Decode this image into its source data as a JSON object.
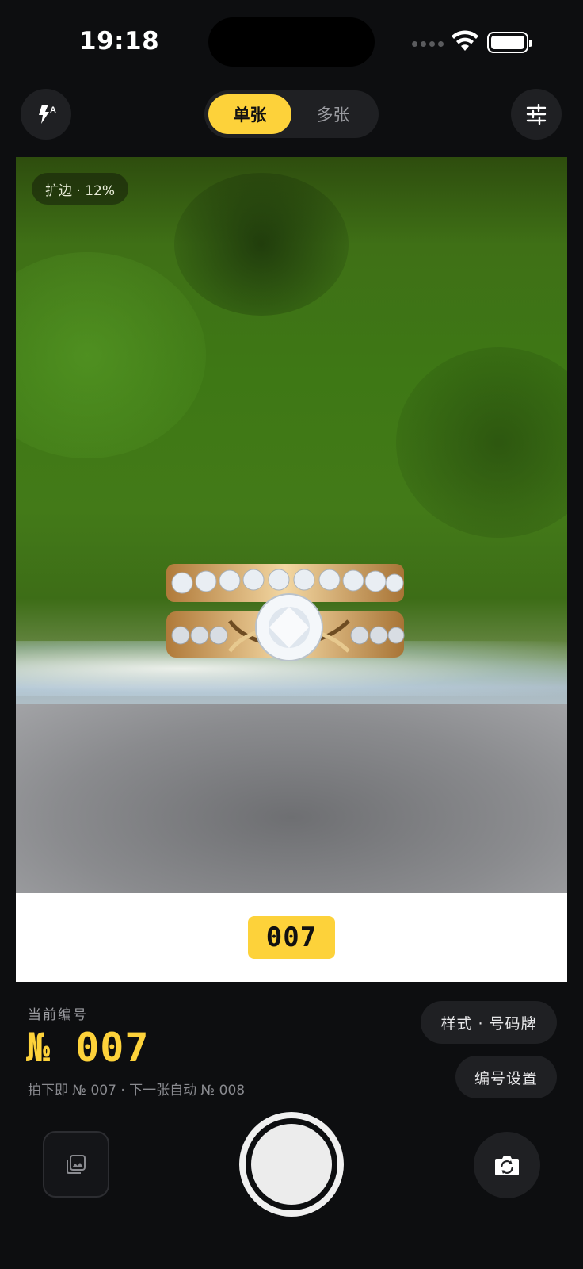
{
  "status_bar": {
    "time": "19:18"
  },
  "top_bar": {
    "flash_icon": "flash-auto-icon",
    "adjust_icon": "sliders-icon",
    "modes": [
      {
        "label": "单张",
        "active": true
      },
      {
        "label": "多张",
        "active": false
      }
    ]
  },
  "viewfinder": {
    "extend_chip": "扩边 · 12%",
    "number_plate": "007"
  },
  "info": {
    "current_label": "当前编号",
    "current_number": "№ 007",
    "hint": "拍下即 № 007 · 下一张自动 № 008",
    "style_button": "样式 · 号码牌",
    "number_settings_button": "编号设置"
  },
  "controls": {
    "gallery_icon": "gallery-icon",
    "shutter_icon": "shutter-button",
    "flip_icon": "camera-flip-icon"
  },
  "colors": {
    "accent": "#fdd23a",
    "background": "#0d0e10",
    "surface": "#1f2023"
  }
}
